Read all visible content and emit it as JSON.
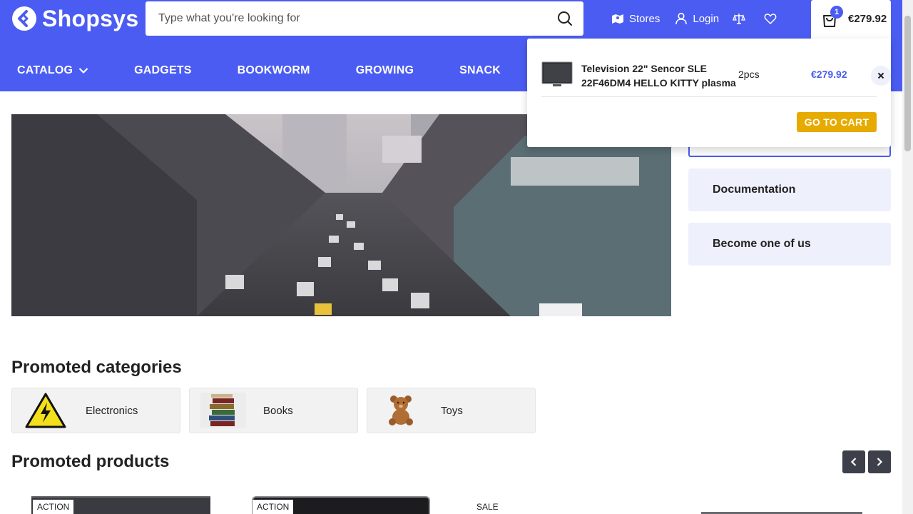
{
  "brand": {
    "name": "Shopsys",
    "accent": "#4b5cf3",
    "cta": "#e7ab00"
  },
  "search": {
    "placeholder": "Type what you're looking for",
    "icon": "search-icon"
  },
  "top_links": {
    "stores": "Stores",
    "login": "Login",
    "compare_icon": "scales-icon",
    "wishlist_icon": "heart-icon"
  },
  "cart": {
    "count": "1",
    "total": "€279.92",
    "icon": "shopping-bag-icon"
  },
  "nav": {
    "items": [
      {
        "label": "CATALOG"
      },
      {
        "label": "GADGETS"
      },
      {
        "label": "BOOKWORM"
      },
      {
        "label": "GROWING"
      },
      {
        "label": "SNACK"
      }
    ]
  },
  "sidebar": {
    "boxes": [
      {
        "label": "Documentation"
      },
      {
        "label": "Become one of us"
      }
    ]
  },
  "promoted_categories": {
    "title": "Promoted categories",
    "items": [
      {
        "label": "Electronics"
      },
      {
        "label": "Books"
      },
      {
        "label": "Toys"
      }
    ]
  },
  "promoted_products": {
    "title": "Promoted products",
    "flags": [
      "ACTION",
      "ACTION",
      "SALE"
    ]
  },
  "cart_dropdown": {
    "item_name": "Television 22\" Sencor SLE 22F46DM4 HELLO KITTY plasma",
    "item_qty": "2pcs",
    "item_price": "€279.92",
    "go_to_cart": "GO TO CART"
  }
}
